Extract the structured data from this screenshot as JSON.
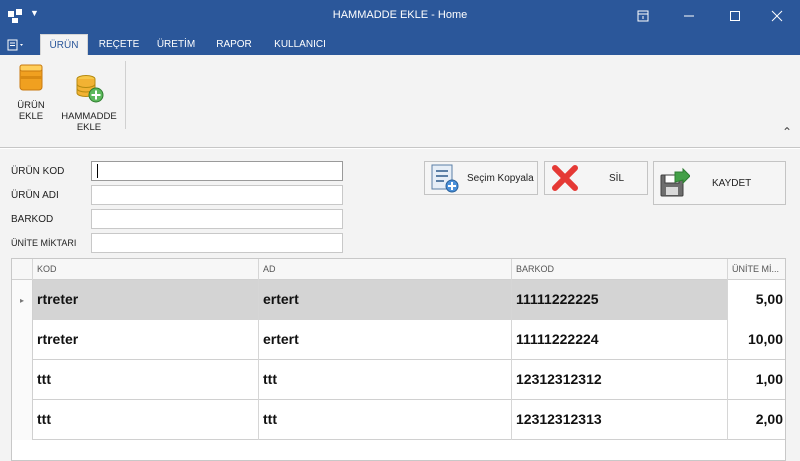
{
  "window": {
    "title": "HAMMADDE EKLE - Home",
    "controls": [
      "ribbon-display-icon",
      "minimize-icon",
      "maximize-icon",
      "close-icon"
    ]
  },
  "ribbon": {
    "tabs": [
      {
        "label": "ÜRÜN",
        "active": true
      },
      {
        "label": "REÇETE",
        "active": false
      },
      {
        "label": "ÜRETİM",
        "active": false
      },
      {
        "label": "RAPOR",
        "active": false
      },
      {
        "label": "KULLANICI",
        "active": false
      }
    ],
    "buttons": [
      {
        "label": "ÜRÜN EKLE",
        "icon": "box-icon"
      },
      {
        "label": "HAMMADDE\nEKLE",
        "icon": "database-add-icon"
      }
    ]
  },
  "form": {
    "fields": [
      {
        "label": "ÜRÜN KOD",
        "value": ""
      },
      {
        "label": "ÜRÜN ADI",
        "value": ""
      },
      {
        "label": "BARKOD",
        "value": ""
      },
      {
        "label": "ÜNİTE MİKTARI",
        "value": ""
      }
    ],
    "actions": {
      "copy": "Seçim Kopyala",
      "delete": "SİL",
      "save": "KAYDET"
    }
  },
  "grid": {
    "columns": [
      "KOD",
      "AD",
      "BARKOD",
      "ÜNİTE Mİ..."
    ],
    "rows": [
      [
        "rtreter",
        "ertert",
        "11111222225",
        "5,00"
      ],
      [
        "rtreter",
        "ertert",
        "11111222224",
        "10,00"
      ],
      [
        "ttt",
        "ttt",
        "12312312312",
        "1,00"
      ],
      [
        "ttt",
        "ttt",
        "12312312313",
        "2,00"
      ]
    ],
    "selected_row": 0,
    "colors": {
      "accent": "#2b579a",
      "selected_row": "#d4d4d4"
    }
  }
}
